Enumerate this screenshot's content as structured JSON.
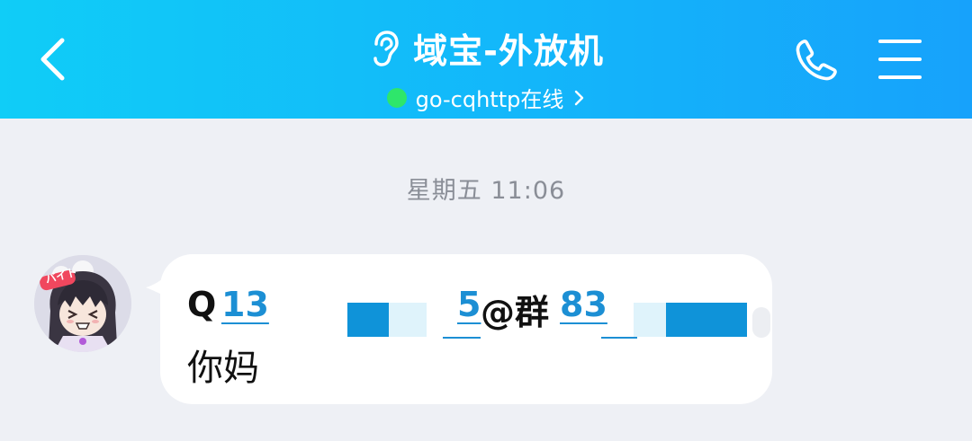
{
  "header": {
    "title": "域宝-外放机",
    "status_text": "go-cqhttp在线",
    "colors": {
      "gradient_start": "#10cdf7",
      "gradient_end": "#17a2fb",
      "online_dot": "#2ee66b"
    },
    "icons": {
      "back": "chevron-left-icon",
      "ear": "ear-icon",
      "status_chevron": "chevron-right-icon",
      "phone": "phone-icon",
      "menu": "menu-icon"
    }
  },
  "chat": {
    "timestamp": "星期五 11:06",
    "messages": [
      {
        "sender_avatar": "avatar-icon",
        "avatar_badge": "バイト",
        "line1": {
          "prefix": "Q",
          "qq_start": "13",
          "qq_end": "5",
          "at_group": "@群",
          "group_start": "83"
        },
        "line2": "你妈"
      }
    ]
  },
  "colors": {
    "link": "#1c8fd4",
    "background": "#eef0f5",
    "bubble": "#ffffff"
  }
}
